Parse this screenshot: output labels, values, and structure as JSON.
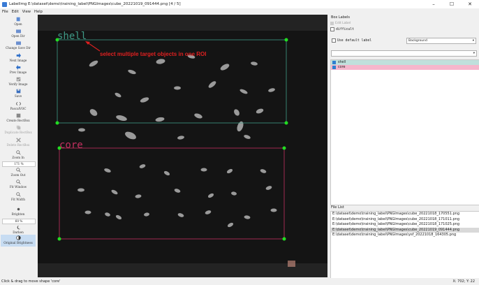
{
  "window": {
    "title": "LabelImg E:\\dataset\\demo\\training_label\\PNGImages\\cube_20221019_091444.png [4 / 5]"
  },
  "menu": [
    "File",
    "Edit",
    "View",
    "Help"
  ],
  "toolbar": [
    {
      "label": "Open"
    },
    {
      "label": "Open Dir"
    },
    {
      "label": "Change Save Dir"
    },
    {
      "label": "Next Image"
    },
    {
      "label": "Prev Image"
    },
    {
      "label": "Verify Image"
    },
    {
      "label": "Save"
    },
    {
      "label": "PascalVOC"
    },
    {
      "label": "Create RectBox"
    },
    {
      "label": "Duplicate RectBox"
    },
    {
      "label": "Delete RectBox"
    },
    {
      "label": "Zoom In"
    },
    {
      "label": "Zoom Out"
    },
    {
      "label": "Fit Window"
    },
    {
      "label": "Fit Width"
    },
    {
      "label": "Brighten"
    },
    {
      "label": "Darken"
    },
    {
      "label": "Original Brightness"
    }
  ],
  "zoom_value": "171 %",
  "brightness_value": "60 %",
  "canvas": {
    "annotation": "select multiple target objects in one ROI",
    "boxes": [
      {
        "label": "shell",
        "color": "#3f9a86"
      },
      {
        "label": "core",
        "color": "#c2305f"
      }
    ]
  },
  "box_labels": {
    "title": "Box Labels",
    "edit_label": "Edit Label",
    "difficult": "difficult",
    "use_default": "Use default label",
    "default_value": "Background",
    "items": [
      {
        "label": "shell",
        "color": "#bfe0dc"
      },
      {
        "label": "core",
        "color": "#f5b6cc"
      }
    ]
  },
  "file_list": {
    "title": "File List",
    "files": [
      "E:\\dataset\\demo\\training_label\\PNGImages\\cube_20221018_170551.png",
      "E:\\dataset\\demo\\training_label\\PNGImages\\cube_20221018_171011.png",
      "E:\\dataset\\demo\\training_label\\PNGImages\\cube_20221018_171025.png",
      "E:\\dataset\\demo\\training_label\\PNGImages\\cube_20221019_091444.png",
      "E:\\dataset\\demo\\training_label\\PNGImages\\ysf_20221018_164305.png"
    ],
    "selected_index": 3
  },
  "status": {
    "message": "Click & drag to move shape 'core'",
    "coords": "X: 702; Y: 22"
  },
  "colors": {
    "accent": "#2f7fd0",
    "point": "#22dd22",
    "arrow": "#e02020"
  }
}
